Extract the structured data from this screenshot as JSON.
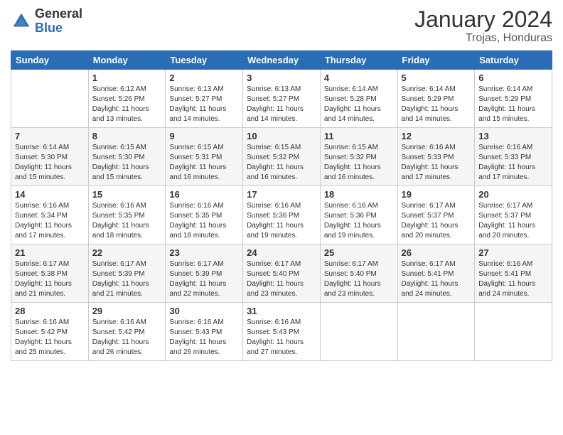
{
  "header": {
    "logo_general": "General",
    "logo_blue": "Blue",
    "title": "January 2024",
    "subtitle": "Trojas, Honduras"
  },
  "weekdays": [
    "Sunday",
    "Monday",
    "Tuesday",
    "Wednesday",
    "Thursday",
    "Friday",
    "Saturday"
  ],
  "weeks": [
    [
      {
        "day": "",
        "sunrise": "",
        "sunset": "",
        "daylight": ""
      },
      {
        "day": "1",
        "sunrise": "Sunrise: 6:12 AM",
        "sunset": "Sunset: 5:26 PM",
        "daylight": "Daylight: 11 hours and 13 minutes."
      },
      {
        "day": "2",
        "sunrise": "Sunrise: 6:13 AM",
        "sunset": "Sunset: 5:27 PM",
        "daylight": "Daylight: 11 hours and 14 minutes."
      },
      {
        "day": "3",
        "sunrise": "Sunrise: 6:13 AM",
        "sunset": "Sunset: 5:27 PM",
        "daylight": "Daylight: 11 hours and 14 minutes."
      },
      {
        "day": "4",
        "sunrise": "Sunrise: 6:14 AM",
        "sunset": "Sunset: 5:28 PM",
        "daylight": "Daylight: 11 hours and 14 minutes."
      },
      {
        "day": "5",
        "sunrise": "Sunrise: 6:14 AM",
        "sunset": "Sunset: 5:29 PM",
        "daylight": "Daylight: 11 hours and 14 minutes."
      },
      {
        "day": "6",
        "sunrise": "Sunrise: 6:14 AM",
        "sunset": "Sunset: 5:29 PM",
        "daylight": "Daylight: 11 hours and 15 minutes."
      }
    ],
    [
      {
        "day": "7",
        "sunrise": "Sunrise: 6:14 AM",
        "sunset": "Sunset: 5:30 PM",
        "daylight": "Daylight: 11 hours and 15 minutes."
      },
      {
        "day": "8",
        "sunrise": "Sunrise: 6:15 AM",
        "sunset": "Sunset: 5:30 PM",
        "daylight": "Daylight: 11 hours and 15 minutes."
      },
      {
        "day": "9",
        "sunrise": "Sunrise: 6:15 AM",
        "sunset": "Sunset: 5:31 PM",
        "daylight": "Daylight: 11 hours and 16 minutes."
      },
      {
        "day": "10",
        "sunrise": "Sunrise: 6:15 AM",
        "sunset": "Sunset: 5:32 PM",
        "daylight": "Daylight: 11 hours and 16 minutes."
      },
      {
        "day": "11",
        "sunrise": "Sunrise: 6:15 AM",
        "sunset": "Sunset: 5:32 PM",
        "daylight": "Daylight: 11 hours and 16 minutes."
      },
      {
        "day": "12",
        "sunrise": "Sunrise: 6:16 AM",
        "sunset": "Sunset: 5:33 PM",
        "daylight": "Daylight: 11 hours and 17 minutes."
      },
      {
        "day": "13",
        "sunrise": "Sunrise: 6:16 AM",
        "sunset": "Sunset: 5:33 PM",
        "daylight": "Daylight: 11 hours and 17 minutes."
      }
    ],
    [
      {
        "day": "14",
        "sunrise": "Sunrise: 6:16 AM",
        "sunset": "Sunset: 5:34 PM",
        "daylight": "Daylight: 11 hours and 17 minutes."
      },
      {
        "day": "15",
        "sunrise": "Sunrise: 6:16 AM",
        "sunset": "Sunset: 5:35 PM",
        "daylight": "Daylight: 11 hours and 18 minutes."
      },
      {
        "day": "16",
        "sunrise": "Sunrise: 6:16 AM",
        "sunset": "Sunset: 5:35 PM",
        "daylight": "Daylight: 11 hours and 18 minutes."
      },
      {
        "day": "17",
        "sunrise": "Sunrise: 6:16 AM",
        "sunset": "Sunset: 5:36 PM",
        "daylight": "Daylight: 11 hours and 19 minutes."
      },
      {
        "day": "18",
        "sunrise": "Sunrise: 6:16 AM",
        "sunset": "Sunset: 5:36 PM",
        "daylight": "Daylight: 11 hours and 19 minutes."
      },
      {
        "day": "19",
        "sunrise": "Sunrise: 6:17 AM",
        "sunset": "Sunset: 5:37 PM",
        "daylight": "Daylight: 11 hours and 20 minutes."
      },
      {
        "day": "20",
        "sunrise": "Sunrise: 6:17 AM",
        "sunset": "Sunset: 5:37 PM",
        "daylight": "Daylight: 11 hours and 20 minutes."
      }
    ],
    [
      {
        "day": "21",
        "sunrise": "Sunrise: 6:17 AM",
        "sunset": "Sunset: 5:38 PM",
        "daylight": "Daylight: 11 hours and 21 minutes."
      },
      {
        "day": "22",
        "sunrise": "Sunrise: 6:17 AM",
        "sunset": "Sunset: 5:39 PM",
        "daylight": "Daylight: 11 hours and 21 minutes."
      },
      {
        "day": "23",
        "sunrise": "Sunrise: 6:17 AM",
        "sunset": "Sunset: 5:39 PM",
        "daylight": "Daylight: 11 hours and 22 minutes."
      },
      {
        "day": "24",
        "sunrise": "Sunrise: 6:17 AM",
        "sunset": "Sunset: 5:40 PM",
        "daylight": "Daylight: 11 hours and 23 minutes."
      },
      {
        "day": "25",
        "sunrise": "Sunrise: 6:17 AM",
        "sunset": "Sunset: 5:40 PM",
        "daylight": "Daylight: 11 hours and 23 minutes."
      },
      {
        "day": "26",
        "sunrise": "Sunrise: 6:17 AM",
        "sunset": "Sunset: 5:41 PM",
        "daylight": "Daylight: 11 hours and 24 minutes."
      },
      {
        "day": "27",
        "sunrise": "Sunrise: 6:16 AM",
        "sunset": "Sunset: 5:41 PM",
        "daylight": "Daylight: 11 hours and 24 minutes."
      }
    ],
    [
      {
        "day": "28",
        "sunrise": "Sunrise: 6:16 AM",
        "sunset": "Sunset: 5:42 PM",
        "daylight": "Daylight: 11 hours and 25 minutes."
      },
      {
        "day": "29",
        "sunrise": "Sunrise: 6:16 AM",
        "sunset": "Sunset: 5:42 PM",
        "daylight": "Daylight: 11 hours and 26 minutes."
      },
      {
        "day": "30",
        "sunrise": "Sunrise: 6:16 AM",
        "sunset": "Sunset: 5:43 PM",
        "daylight": "Daylight: 11 hours and 26 minutes."
      },
      {
        "day": "31",
        "sunrise": "Sunrise: 6:16 AM",
        "sunset": "Sunset: 5:43 PM",
        "daylight": "Daylight: 11 hours and 27 minutes."
      },
      {
        "day": "",
        "sunrise": "",
        "sunset": "",
        "daylight": ""
      },
      {
        "day": "",
        "sunrise": "",
        "sunset": "",
        "daylight": ""
      },
      {
        "day": "",
        "sunrise": "",
        "sunset": "",
        "daylight": ""
      }
    ]
  ]
}
